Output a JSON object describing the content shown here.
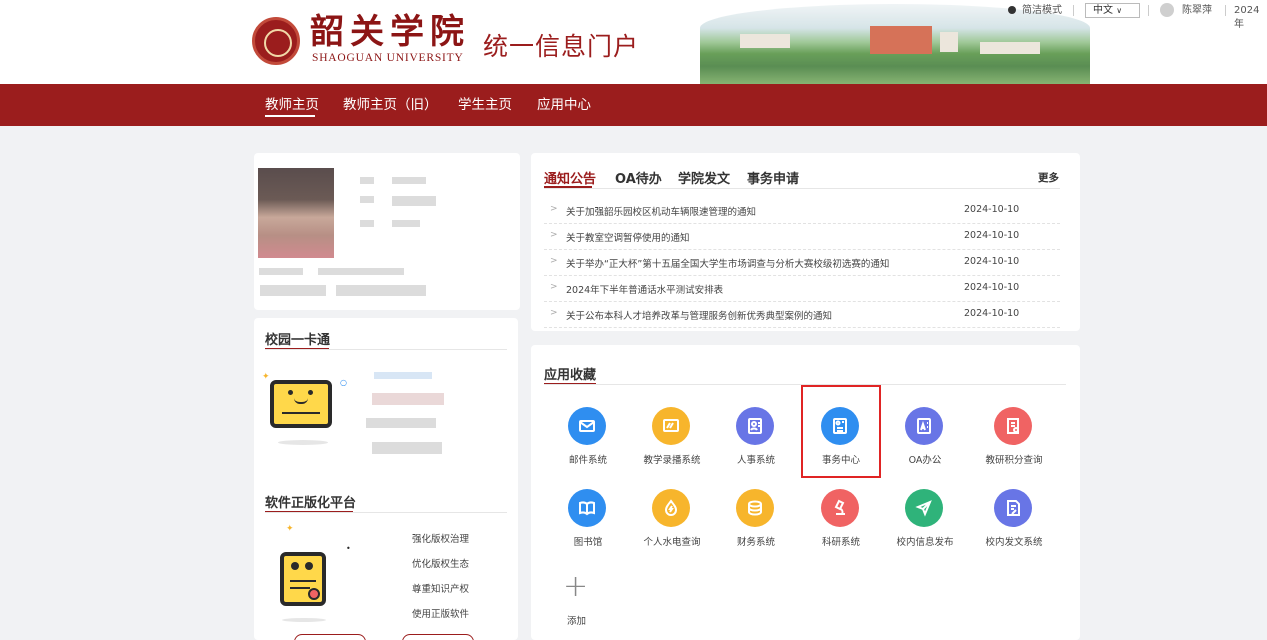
{
  "header": {
    "logo_cn": "韶关学院",
    "logo_en": "SHAOGUAN UNIVERSITY",
    "portal_title": "统一信息门户",
    "simple_mode": "简洁模式",
    "language": "中文",
    "user_name": "陈翠萍",
    "date_fragment": "2024年"
  },
  "nav": {
    "items": [
      "教师主页",
      "教师主页（旧）",
      "学生主页",
      "应用中心"
    ],
    "active_index": 0
  },
  "campus_card": {
    "title": "校园一卡通"
  },
  "software_platform": {
    "title": "软件正版化平台",
    "items": [
      "强化版权治理",
      "优化版权生态",
      "尊重知识产权",
      "使用正版软件"
    ]
  },
  "notices": {
    "tabs": [
      "通知公告",
      "OA待办",
      "学院发文",
      "事务申请"
    ],
    "active_tab": 0,
    "more": "更多",
    "items": [
      {
        "title": "关于加强韶乐园校区机动车辆限速管理的通知",
        "date": "2024-10-10"
      },
      {
        "title": "关于教室空调暂停使用的通知",
        "date": "2024-10-10"
      },
      {
        "title": "关于举办“正大杯”第十五届全国大学生市场调查与分析大赛校级初选赛的通知",
        "date": "2024-10-10"
      },
      {
        "title": "2024年下半年普通话水平测试安排表",
        "date": "2024-10-10"
      },
      {
        "title": "关于公布本科人才培养改革与管理服务创新优秀典型案例的通知",
        "date": "2024-10-10"
      }
    ]
  },
  "apps": {
    "title": "应用收藏",
    "add_label": "添加",
    "items": [
      {
        "label": "邮件系统",
        "icon": "mail-icon",
        "color": "#2f8ef0"
      },
      {
        "label": "教学录播系统",
        "icon": "video-icon",
        "color": "#f7b52c"
      },
      {
        "label": "人事系统",
        "icon": "id-card-icon",
        "color": "#6875e6"
      },
      {
        "label": "事务中心",
        "icon": "task-card-icon",
        "color": "#2f8ef0"
      },
      {
        "label": "OA办公",
        "icon": "office-icon",
        "color": "#6875e6"
      },
      {
        "label": "教研积分查询",
        "icon": "document-icon",
        "color": "#f06363"
      },
      {
        "label": "图书馆",
        "icon": "book-icon",
        "color": "#2f8ef0"
      },
      {
        "label": "个人水电查询",
        "icon": "utility-icon",
        "color": "#f7b52c"
      },
      {
        "label": "财务系统",
        "icon": "coin-icon",
        "color": "#f7b52c"
      },
      {
        "label": "科研系统",
        "icon": "microscope-icon",
        "color": "#f06363"
      },
      {
        "label": "校内信息发布",
        "icon": "send-icon",
        "color": "#2fb37a"
      },
      {
        "label": "校内发文系统",
        "icon": "file-edit-icon",
        "color": "#6875e6"
      }
    ],
    "highlighted_index": 3
  }
}
